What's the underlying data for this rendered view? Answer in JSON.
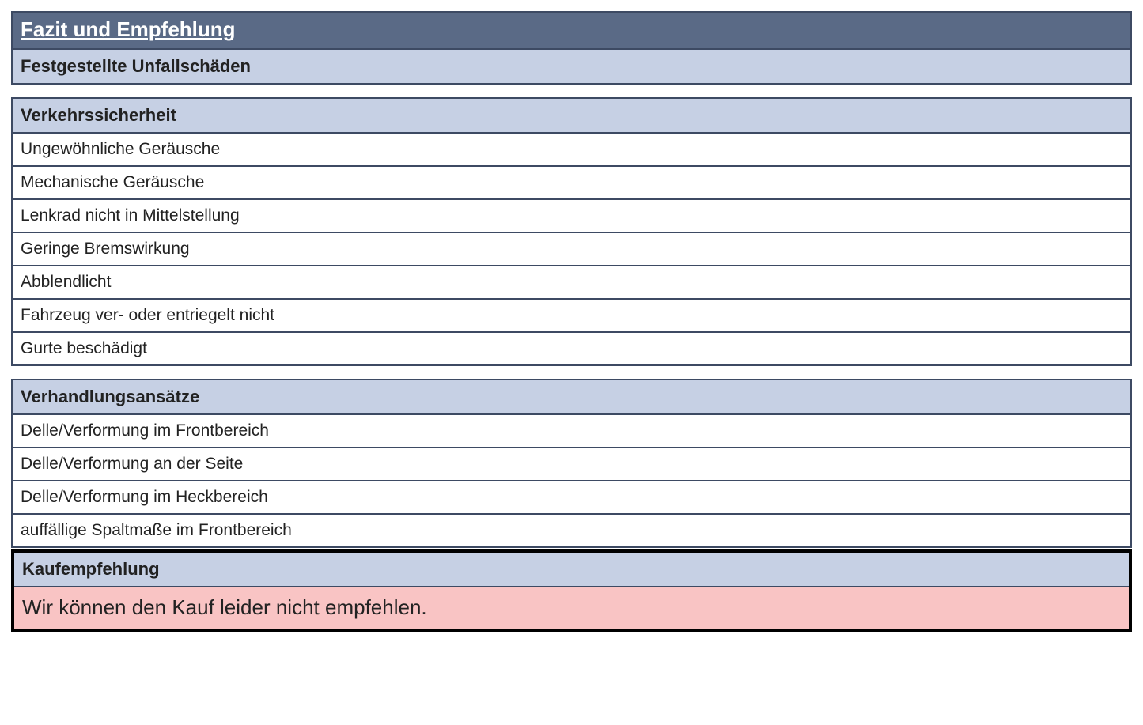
{
  "title": "Fazit und Empfehlung",
  "sections": {
    "accident": {
      "header": "Festgestellte Unfallschäden"
    },
    "safety": {
      "header": "Verkehrssicherheit",
      "items": [
        "Ungewöhnliche Geräusche",
        "Mechanische Geräusche",
        "Lenkrad nicht in Mittelstellung",
        "Geringe Bremswirkung",
        "Abblendlicht",
        "Fahrzeug ver- oder entriegelt nicht",
        "Gurte beschädigt"
      ]
    },
    "negotiation": {
      "header": "Verhandlungsansätze",
      "items": [
        "Delle/Verformung im Frontbereich",
        "Delle/Verformung an der Seite",
        "Delle/Verformung im Heckbereich",
        "auffällige Spaltmaße im Frontbereich"
      ]
    },
    "recommendation": {
      "header": "Kaufempfehlung",
      "text": "Wir können den Kauf leider nicht empfehlen."
    }
  }
}
